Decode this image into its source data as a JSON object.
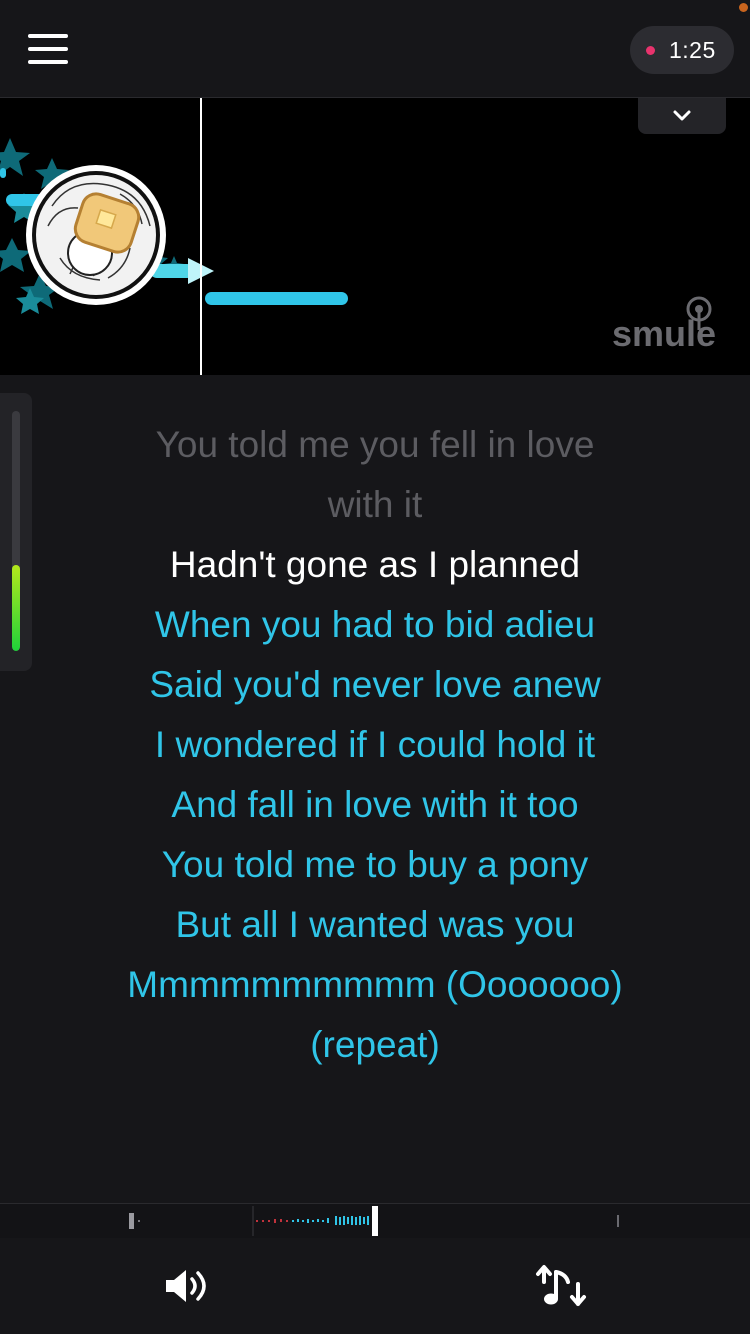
{
  "header": {
    "menu_icon": "hamburger-menu-icon",
    "timer": "1:25",
    "recording_indicator_color": "#e8336d"
  },
  "stage": {
    "collapse_icon": "chevron-down-icon",
    "watermark": "smule",
    "pitch_bar_color": "#30c5e8"
  },
  "lyrics": {
    "past": [
      "You told me you fell in love",
      "with it"
    ],
    "current": "Hadn't gone as I planned",
    "upcoming": [
      "When you had to bid adieu",
      "Said you'd never love anew",
      "I wondered if I could hold it",
      "And fall in love with it too",
      "You told me to buy a pony",
      "But all I wanted was you",
      "Mmmmmmmmmm (Ooooooo)",
      "(repeat)"
    ]
  },
  "level_meter": {
    "level": 0.36
  },
  "scrubber": {
    "progress": 0.5
  },
  "footer": {
    "volume_icon": "speaker-volume-icon",
    "pitch_icon": "pitch-up-down-icon"
  },
  "colors": {
    "background": "#161619",
    "accent": "#30c5e8",
    "current_line": "#ffffff",
    "past_line": "#5c5c61"
  }
}
